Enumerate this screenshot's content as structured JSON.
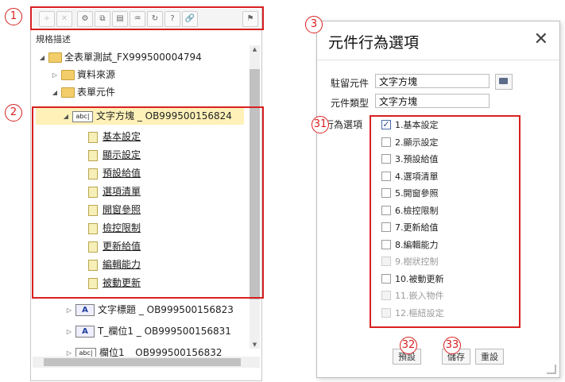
{
  "callouts": [
    "1",
    "2",
    "3",
    "31",
    "32",
    "33"
  ],
  "tree_panel": {
    "title": "規格描述",
    "toolbar": [
      "+",
      "✕",
      "⚙",
      "⧉",
      "▤",
      "♒",
      "↻",
      "?",
      "🔗",
      "⚑"
    ],
    "nodes": [
      {
        "label": "全表單測試_FX999500004794"
      },
      {
        "label": "資料來源"
      },
      {
        "label": "表單元件"
      },
      {
        "label": "文字方塊 _ OB999500156824",
        "icon": "abc"
      },
      {
        "label": "基本設定"
      },
      {
        "label": "顯示設定"
      },
      {
        "label": "預設給值"
      },
      {
        "label": "選項清單"
      },
      {
        "label": "開窗參照"
      },
      {
        "label": "檢控限制"
      },
      {
        "label": "更新給值"
      },
      {
        "label": "編輯能力"
      },
      {
        "label": "被動更新"
      },
      {
        "label": "文字標題 _ OB999500156823",
        "icon": "A"
      },
      {
        "label": "T_欄位1 _ OB999500156831",
        "icon": "A"
      },
      {
        "label": "欄位1 _ OB999500156832",
        "icon": "abc"
      }
    ]
  },
  "dialog": {
    "title": "元件行為選項",
    "close": "✕",
    "resident_label": "駐留元件",
    "resident_value": "文字方塊",
    "type_label": "元件類型",
    "type_value": "文字方塊",
    "options_label": "行為選項",
    "options": [
      {
        "label": "1.基本設定",
        "checked": true,
        "enabled": true
      },
      {
        "label": "2.顯示設定",
        "checked": false,
        "enabled": true
      },
      {
        "label": "3.預設給值",
        "checked": false,
        "enabled": true
      },
      {
        "label": "4.選項清單",
        "checked": false,
        "enabled": true
      },
      {
        "label": "5.開窗參照",
        "checked": false,
        "enabled": true
      },
      {
        "label": "6.檢控限制",
        "checked": false,
        "enabled": true
      },
      {
        "label": "7.更新給值",
        "checked": false,
        "enabled": true
      },
      {
        "label": "8.編輯能力",
        "checked": false,
        "enabled": true
      },
      {
        "label": "9.樹狀控制",
        "checked": false,
        "enabled": false
      },
      {
        "label": "10.被動更新",
        "checked": false,
        "enabled": true
      },
      {
        "label": "11.嵌入物件",
        "checked": false,
        "enabled": false
      },
      {
        "label": "12.樞紐設定",
        "checked": false,
        "enabled": false
      }
    ],
    "buttons": {
      "default": "預設",
      "save": "儲存",
      "reset": "重設"
    }
  },
  "colors": {
    "callout": "#d92020",
    "selected_row": "#fff1b8",
    "folder": "#f2cd6a"
  }
}
